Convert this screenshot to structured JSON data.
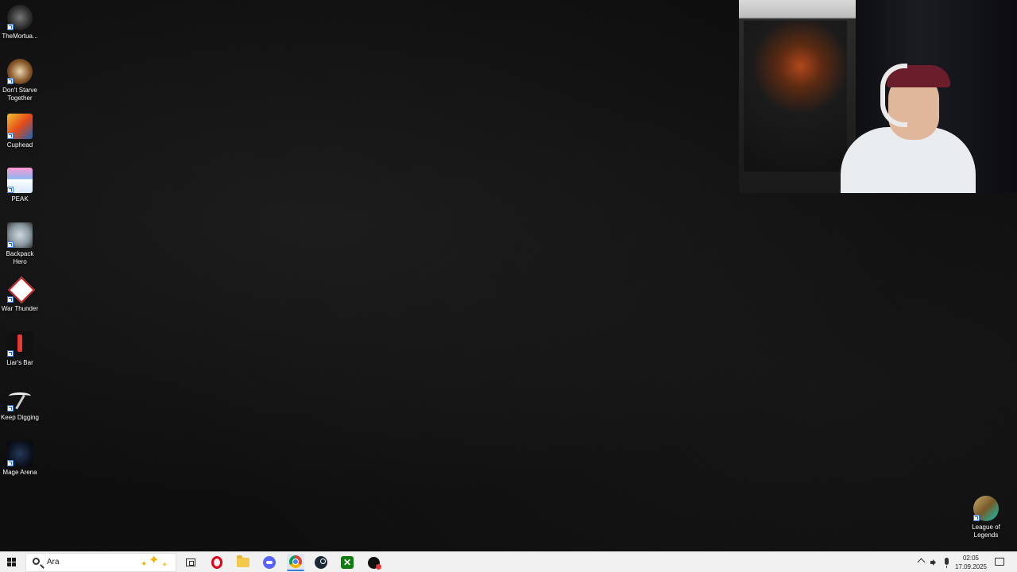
{
  "desktop": {
    "icons": [
      {
        "label": "TheMortua...",
        "icon": "the-mortuary-assistant-icon"
      },
      {
        "label": "Don't Starve Together",
        "icon": "dont-starve-together-icon"
      },
      {
        "label": "Cuphead",
        "icon": "cuphead-icon"
      },
      {
        "label": "PEAK",
        "icon": "peak-icon"
      },
      {
        "label": "Backpack Hero",
        "icon": "backpack-hero-icon"
      },
      {
        "label": "War Thunder",
        "icon": "war-thunder-icon"
      },
      {
        "label": "Liar's Bar",
        "icon": "liars-bar-icon"
      },
      {
        "label": "Keep Digging",
        "icon": "keep-digging-icon"
      },
      {
        "label": "Mage Arena",
        "icon": "mage-arena-icon"
      },
      {
        "label": "League of Legends",
        "icon": "league-of-legends-icon"
      }
    ]
  },
  "taskbar": {
    "search_placeholder": "Ara",
    "apps": [
      "task-view",
      "opera",
      "file-explorer",
      "discord",
      "chrome",
      "steam",
      "xbox",
      "app"
    ],
    "active_app": "chrome",
    "clock_time": "02:05",
    "clock_date": "17.09.2025"
  }
}
